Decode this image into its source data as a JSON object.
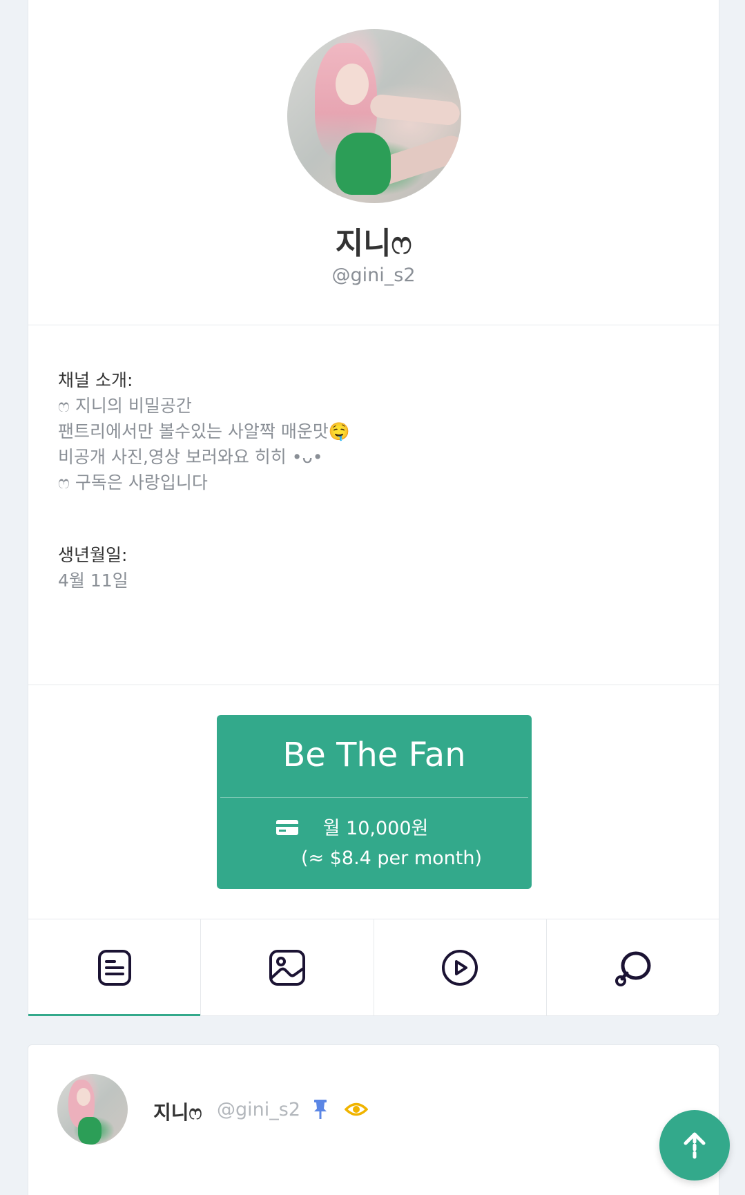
{
  "profile": {
    "name": "지니ෆ",
    "handle": "@gini_s2"
  },
  "bio": {
    "intro_label": "채널 소개:",
    "intro_lines": [
      "ෆ 지니의 비밀공간",
      "팬트리에서만 볼수있는 사알짝 매운맛🤤",
      "비공개 사진,영상 보러와요 히히 •ᴗ•",
      "ෆ 구독은 사랑입니다"
    ],
    "birthday_label": "생년월일:",
    "birthday_value": "4월 11일"
  },
  "subscribe": {
    "title": "Be The Fan",
    "price": "월 10,000원",
    "usd": "(≈ $8.4 per month)",
    "icon": "credit-card-icon"
  },
  "tabs": [
    {
      "name": "posts",
      "icon": "document-icon",
      "active": true
    },
    {
      "name": "photos",
      "icon": "image-icon",
      "active": false
    },
    {
      "name": "videos",
      "icon": "play-icon",
      "active": false
    },
    {
      "name": "chat",
      "icon": "chat-bubbles-icon",
      "active": false
    }
  ],
  "post": {
    "author": "지니ෆ",
    "handle": "@gini_s2",
    "pinned_icon": "pin-icon",
    "visibility_icon": "eye-icon"
  },
  "colors": {
    "accent": "#33a98b",
    "pin": "#5b86e5",
    "eye": "#f0b400"
  }
}
